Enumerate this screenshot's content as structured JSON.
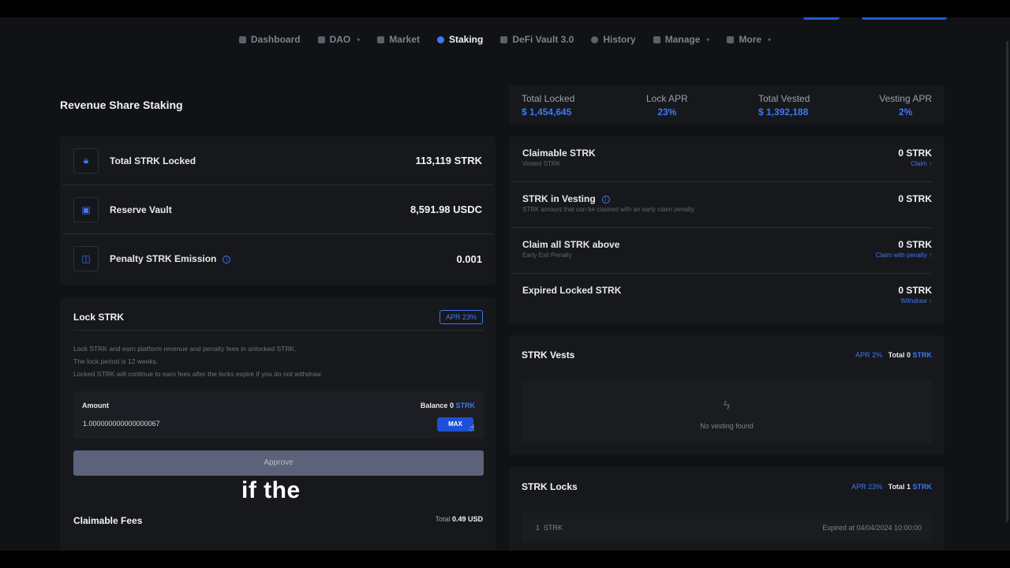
{
  "nav": {
    "items": [
      {
        "label": "Dashboard",
        "icon": "grid-icon",
        "active": false,
        "dropdown": false
      },
      {
        "label": "DAO",
        "icon": "doc-icon",
        "active": false,
        "dropdown": true
      },
      {
        "label": "Market",
        "icon": "bars-icon",
        "active": false,
        "dropdown": false
      },
      {
        "label": "Staking",
        "icon": "staking-icon",
        "active": true,
        "dropdown": false
      },
      {
        "label": "DeFi Vault 3.0",
        "icon": "vault-icon",
        "active": false,
        "dropdown": false
      },
      {
        "label": "History",
        "icon": "clock-icon",
        "active": false,
        "dropdown": false
      },
      {
        "label": "Manage",
        "icon": "sliders-icon",
        "active": false,
        "dropdown": true
      },
      {
        "label": "More",
        "icon": "more-icon",
        "active": false,
        "dropdown": true
      }
    ]
  },
  "page_title": "Revenue Share Staking",
  "summary": {
    "rows": [
      {
        "label": "Total STRK Locked",
        "value": "113,119 STRK",
        "icon": "lock-icon",
        "info": false
      },
      {
        "label": "Reserve Vault",
        "value": "8,591.98 USDC",
        "icon": "vault-box-icon",
        "info": false
      },
      {
        "label": "Penalty STRK Emission",
        "value": "0.001",
        "icon": "coins-icon",
        "info": true
      }
    ]
  },
  "lock": {
    "title": "Lock STRK",
    "apr_badge": "APR 23%",
    "desc1": "Lock STRK and earn platform revenue and penalty fees in unlocked STRK.",
    "desc2": "The lock period is 12 weeks.",
    "desc3": "Locked STRK will continue to earn fees after the locks expire if you do not withdraw.",
    "amount_label": "Amount",
    "balance_label": "Balance",
    "balance_value": "0",
    "balance_token": "STRK",
    "amount_value": "1.000000000000000067",
    "max_label": "MAX",
    "approve_label": "Approve"
  },
  "fees": {
    "title": "Claimable Fees",
    "total_label": "Total",
    "total_value": "0.49 USD"
  },
  "stats": [
    {
      "label": "Total Locked",
      "value": "$ 1,454,645"
    },
    {
      "label": "Lock APR",
      "value": "23%"
    },
    {
      "label": "Total Vested",
      "value": "$ 1,392,188"
    },
    {
      "label": "Vesting APR",
      "value": "2%"
    }
  ],
  "claims": [
    {
      "title": "Claimable STRK",
      "sub": "Vested STRK",
      "value": "0 STRK",
      "action": "Claim ↑",
      "info": false
    },
    {
      "title": "STRK in Vesting",
      "sub": "STRK amount that can be claimed with an early claim penalty",
      "value": "0 STRK",
      "action": "",
      "info": true
    },
    {
      "title": "Claim all STRK above",
      "sub": "Early Exit Penalty",
      "value": "0 STRK",
      "action": "Claim with penalty ↑",
      "info": false
    },
    {
      "title": "Expired Locked STRK",
      "sub": "",
      "value": "0 STRK",
      "action": "Withdraw ↑",
      "info": false
    }
  ],
  "vests": {
    "title": "STRK Vests",
    "apr": "APR 2%",
    "total_label": "Total",
    "total_value": "0",
    "token": "STRK",
    "empty": "No vesting found"
  },
  "locks": {
    "title": "STRK Locks",
    "apr": "APR 23%",
    "total_label": "Total",
    "total_value": "1",
    "token": "STRK",
    "rows": [
      {
        "amount": "1",
        "token": "STRK",
        "status": "Expired at 04/04/2024 10:00:00"
      }
    ]
  },
  "caption": "if the",
  "colors": {
    "accent": "#3f78f2",
    "bg": "#101215",
    "panel": "#16181c"
  }
}
